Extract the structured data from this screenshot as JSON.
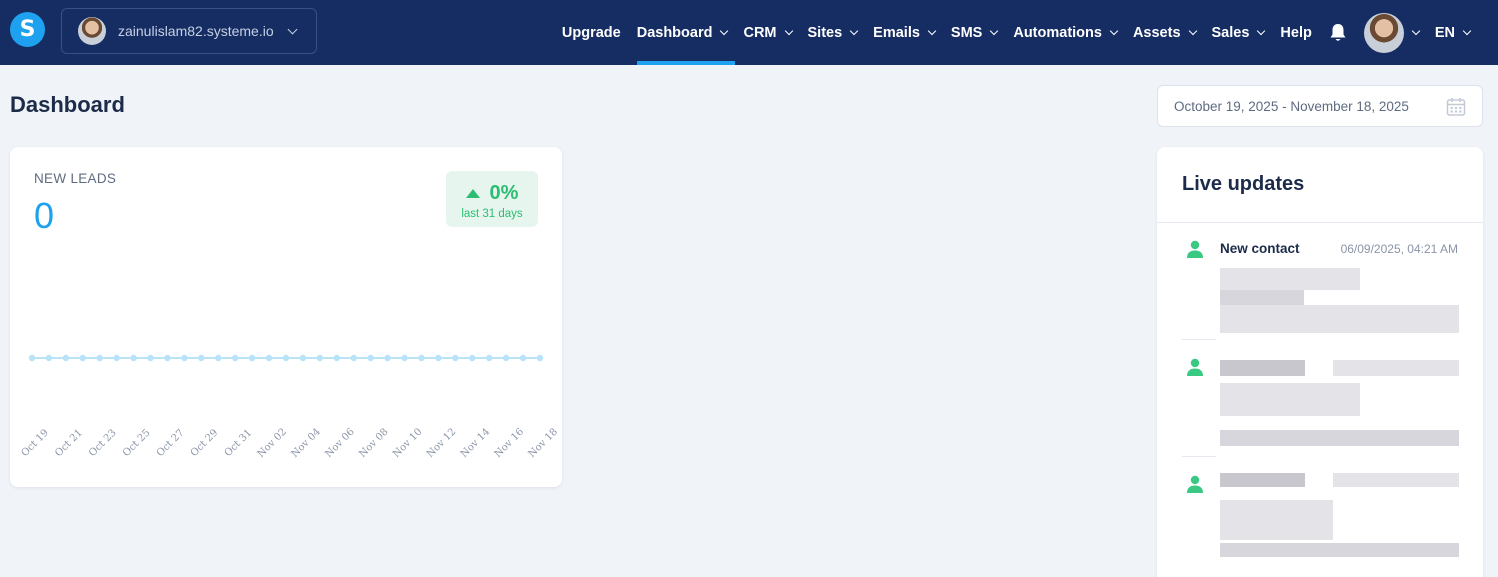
{
  "brand": {
    "logo_letter": "S"
  },
  "site_selector": {
    "name": "zainulislam82.systeme.io"
  },
  "nav": {
    "items": [
      {
        "label": "Upgrade",
        "dropdown": false,
        "active": false
      },
      {
        "label": "Dashboard",
        "dropdown": true,
        "active": true
      },
      {
        "label": "CRM",
        "dropdown": true,
        "active": false
      },
      {
        "label": "Sites",
        "dropdown": true,
        "active": false
      },
      {
        "label": "Emails",
        "dropdown": true,
        "active": false
      },
      {
        "label": "SMS",
        "dropdown": true,
        "active": false
      },
      {
        "label": "Automations",
        "dropdown": true,
        "active": false
      },
      {
        "label": "Assets",
        "dropdown": true,
        "active": false
      },
      {
        "label": "Sales",
        "dropdown": true,
        "active": false
      },
      {
        "label": "Help",
        "dropdown": false,
        "active": false
      }
    ],
    "language": "EN"
  },
  "page": {
    "title": "Dashboard",
    "date_range": "October 19, 2025 - November 18, 2025"
  },
  "leads": {
    "label": "NEW LEADS",
    "value": "0",
    "change": "0%",
    "period": "last 31 days"
  },
  "chart_data": {
    "type": "line",
    "x": [
      "Oct 19",
      "Oct 20",
      "Oct 21",
      "Oct 22",
      "Oct 23",
      "Oct 24",
      "Oct 25",
      "Oct 26",
      "Oct 27",
      "Oct 28",
      "Oct 29",
      "Oct 30",
      "Oct 31",
      "Nov 01",
      "Nov 02",
      "Nov 03",
      "Nov 04",
      "Nov 05",
      "Nov 06",
      "Nov 07",
      "Nov 08",
      "Nov 09",
      "Nov 10",
      "Nov 11",
      "Nov 12",
      "Nov 13",
      "Nov 14",
      "Nov 15",
      "Nov 16",
      "Nov 17",
      "Nov 18"
    ],
    "tick_labels": [
      "Oct 19",
      "Oct 21",
      "Oct 23",
      "Oct 25",
      "Oct 27",
      "Oct 29",
      "Oct 31",
      "Nov 02",
      "Nov 04",
      "Nov 06",
      "Nov 08",
      "Nov 10",
      "Nov 12",
      "Nov 14",
      "Nov 16",
      "Nov 18"
    ],
    "series": [
      {
        "values": [
          0,
          0,
          0,
          0,
          0,
          0,
          0,
          0,
          0,
          0,
          0,
          0,
          0,
          0,
          0,
          0,
          0,
          0,
          0,
          0,
          0,
          0,
          0,
          0,
          0,
          0,
          0,
          0,
          0,
          0,
          0
        ]
      }
    ],
    "grid": false,
    "color": "#b9e3f8"
  },
  "live_updates": {
    "title": "Live updates",
    "items": [
      {
        "title": "New contact",
        "time": "06/09/2025, 04:21 AM",
        "icon": "user-icon"
      },
      {
        "title": "",
        "time": "",
        "icon": "user-icon"
      },
      {
        "title": "",
        "time": "",
        "icon": "user-icon"
      }
    ]
  },
  "colors": {
    "navbar": "#162d63",
    "accent": "#1ea1ee",
    "success": "#2cbd72"
  }
}
